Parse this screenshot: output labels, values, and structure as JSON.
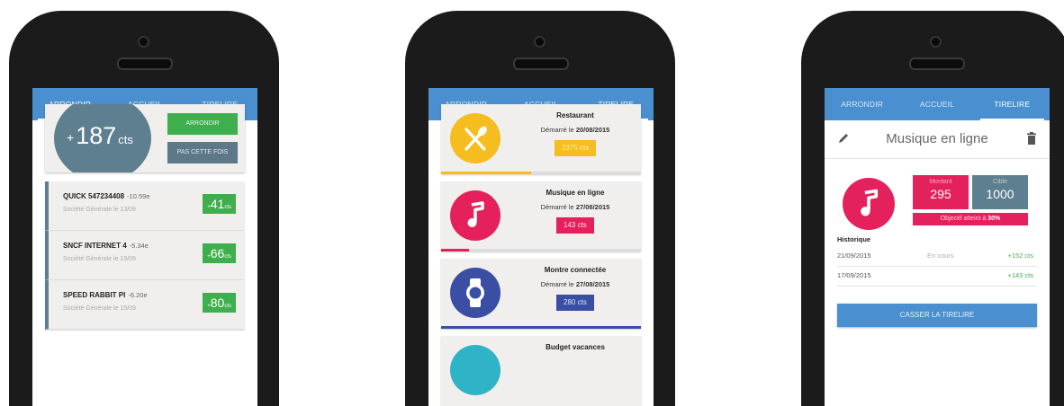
{
  "phones": [
    {
      "tabs": [
        "ARRONDIR",
        "ACCUEIL",
        "TIRELIRE"
      ],
      "active_tab": 0,
      "round": {
        "plus": "+",
        "amount": "187",
        "unit": "cts",
        "btn_arrondir": "ARRONDIR",
        "btn_pas": "PAS CETTE FOIS"
      },
      "transactions": [
        {
          "name": "QUICK 547234408",
          "amount": "-10.59e",
          "bank": "Société Générale le 13/09",
          "badge_plus": "+",
          "badge_value": "41",
          "badge_unit": "cts"
        },
        {
          "name": "SNCF INTERNET 4",
          "amount": "-5.34e",
          "bank": "Société Générale le 19/09",
          "badge_plus": "+",
          "badge_value": "66",
          "badge_unit": "cts"
        },
        {
          "name": "SPEED RABBIT PI",
          "amount": "-6.20e",
          "bank": "Société Générale le 15/09",
          "badge_plus": "+",
          "badge_value": "80",
          "badge_unit": "cts"
        }
      ]
    },
    {
      "tabs": [
        "ARRONDIR",
        "ACCUEIL",
        "TIRELIRE"
      ],
      "active_tab": 2,
      "goals": [
        {
          "title": "Restaurant",
          "started": "Démarré le",
          "date": "20/08/2015",
          "pill": "2375 cts",
          "color": "#f5bd1f",
          "pill_text": "#fbe9b0",
          "icon": "fork-knife-icon",
          "progress": 0.45
        },
        {
          "title": "Musique en ligne",
          "started": "Démarré le",
          "date": "27/08/2015",
          "pill": "143 cts",
          "color": "#e5215d",
          "pill_text": "#ffe1ea",
          "icon": "music-note-icon",
          "progress": 0.14
        },
        {
          "title": "Montre connectée",
          "started": "Démarré le",
          "date": "27/08/2015",
          "pill": "280 cts",
          "color": "#3a4ea3",
          "pill_text": "#dfe4f7",
          "icon": "watch-icon",
          "progress": 1.0
        },
        {
          "title": "Budget vacances",
          "started": "",
          "date": "",
          "pill": "",
          "color": "#2fb3c6",
          "pill_text": "#ffffff",
          "icon": "budget-icon",
          "progress": 0
        }
      ]
    },
    {
      "tabs": [
        "ARRONDIR",
        "ACCUEIL",
        "TIRELIRE"
      ],
      "active_tab": 2,
      "title": "Musique en ligne",
      "montant_label": "Montant",
      "montant": "295",
      "cible_label": "Cible",
      "cible": "1000",
      "objectif_text": "Objectif atteint à",
      "objectif_pct": "30%",
      "progress": 0.3,
      "historique_label": "Historique",
      "history": [
        {
          "date": "21/09/2015",
          "status": "En cours",
          "value": "+152 cts"
        },
        {
          "date": "17/09/2015",
          "status": "",
          "value": "+143 cts"
        }
      ],
      "casser_label": "CASSER LA TIRELIRE"
    }
  ],
  "colors": {
    "tabbar": "#4a8fd0",
    "green": "#3fae4c",
    "slate": "#5e7f8f",
    "pink": "#e5215d"
  }
}
